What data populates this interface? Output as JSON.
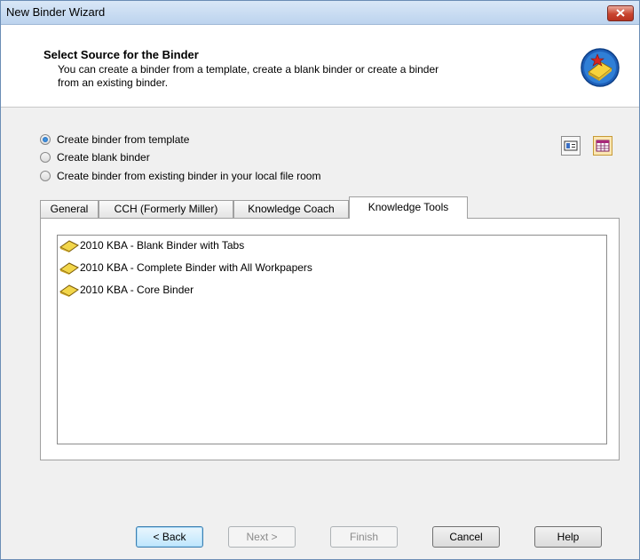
{
  "window": {
    "title": "New Binder Wizard"
  },
  "header": {
    "title": "Select Source for the Binder",
    "description_line1": "You can create a binder from a template, create a blank binder or create a binder",
    "description_line2": "from an existing binder."
  },
  "options": [
    {
      "label": "Create binder from template",
      "checked": true
    },
    {
      "label": "Create blank binder",
      "checked": false
    },
    {
      "label": "Create binder from existing binder in your local file room",
      "checked": false
    }
  ],
  "view_toggle": {
    "detail_icon": "details-view-icon",
    "grid_icon": "grid-view-icon",
    "selected": "grid"
  },
  "tabs": [
    {
      "label": "General",
      "active": false
    },
    {
      "label": "CCH (Formerly Miller)",
      "active": false
    },
    {
      "label": "Knowledge Coach",
      "active": false
    },
    {
      "label": "Knowledge Tools",
      "active": true
    }
  ],
  "templates": [
    {
      "label": "2010 KBA - Blank Binder with Tabs",
      "icon": "binder-book-icon"
    },
    {
      "label": "2010 KBA - Complete Binder with All Workpapers",
      "icon": "binder-book-icon"
    },
    {
      "label": "2010 KBA - Core Binder",
      "icon": "binder-book-icon"
    }
  ],
  "buttons": {
    "back": "< Back",
    "next": "Next >",
    "finish": "Finish",
    "cancel": "Cancel",
    "help": "Help"
  },
  "colors": {
    "titlebar": "#bcd3ee",
    "close": "#c9452f",
    "default_button": "#bee6fd",
    "binder_icon": "#f2d64a"
  }
}
